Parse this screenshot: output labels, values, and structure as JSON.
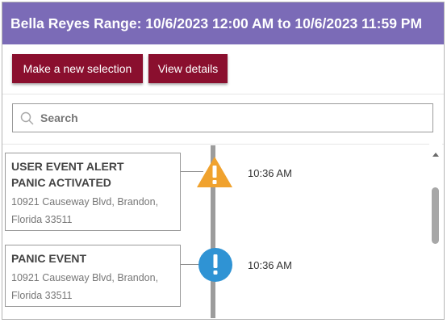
{
  "header": {
    "title": "Bella Reyes Range: 10/6/2023 12:00 AM to 10/6/2023 11:59 PM"
  },
  "toolbar": {
    "new_selection_label": "Make a new selection",
    "view_details_label": "View details"
  },
  "search": {
    "placeholder": "Search",
    "value": ""
  },
  "events": [
    {
      "title_line1": "USER EVENT ALERT",
      "title_line2": "PANIC ACTIVATED",
      "address_line1": "10921 Causeway Blvd, Brandon,",
      "address_line2": "Florida 33511",
      "time": "10:36 AM",
      "icon": "warning-triangle-icon",
      "icon_color": "#f0a22e"
    },
    {
      "title_line1": "PANIC EVENT",
      "address_line1": "10921 Causeway Blvd, Brandon,",
      "address_line2": "Florida 33511",
      "time": "10:36 AM",
      "icon": "alert-circle-icon",
      "icon_color": "#2f93d4"
    }
  ],
  "colors": {
    "header_bg": "#7b6bb7",
    "button_bg": "#8a0f2e",
    "timeline_line": "#9c9c9c"
  }
}
